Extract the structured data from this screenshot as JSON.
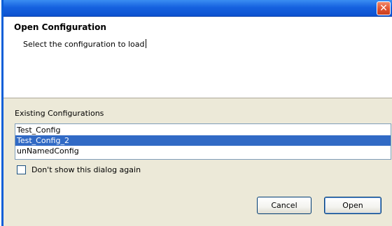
{
  "window": {
    "title": "",
    "close_glyph": "✕"
  },
  "header": {
    "title": "Open Configuration",
    "message": "Select the configuration to load"
  },
  "configurations": {
    "label": "Existing Configurations",
    "items": [
      "Test_Config",
      "Test_Config_2",
      "unNamedConfig"
    ],
    "selected_index": 1
  },
  "options": {
    "dont_show_label": "Don't show this dialog again",
    "dont_show_checked": false
  },
  "buttons": {
    "cancel": "Cancel",
    "open": "Open"
  },
  "colors": {
    "titlebar": "#0c51cf",
    "selection": "#316ac5",
    "dialog_bg": "#ece9d8"
  }
}
